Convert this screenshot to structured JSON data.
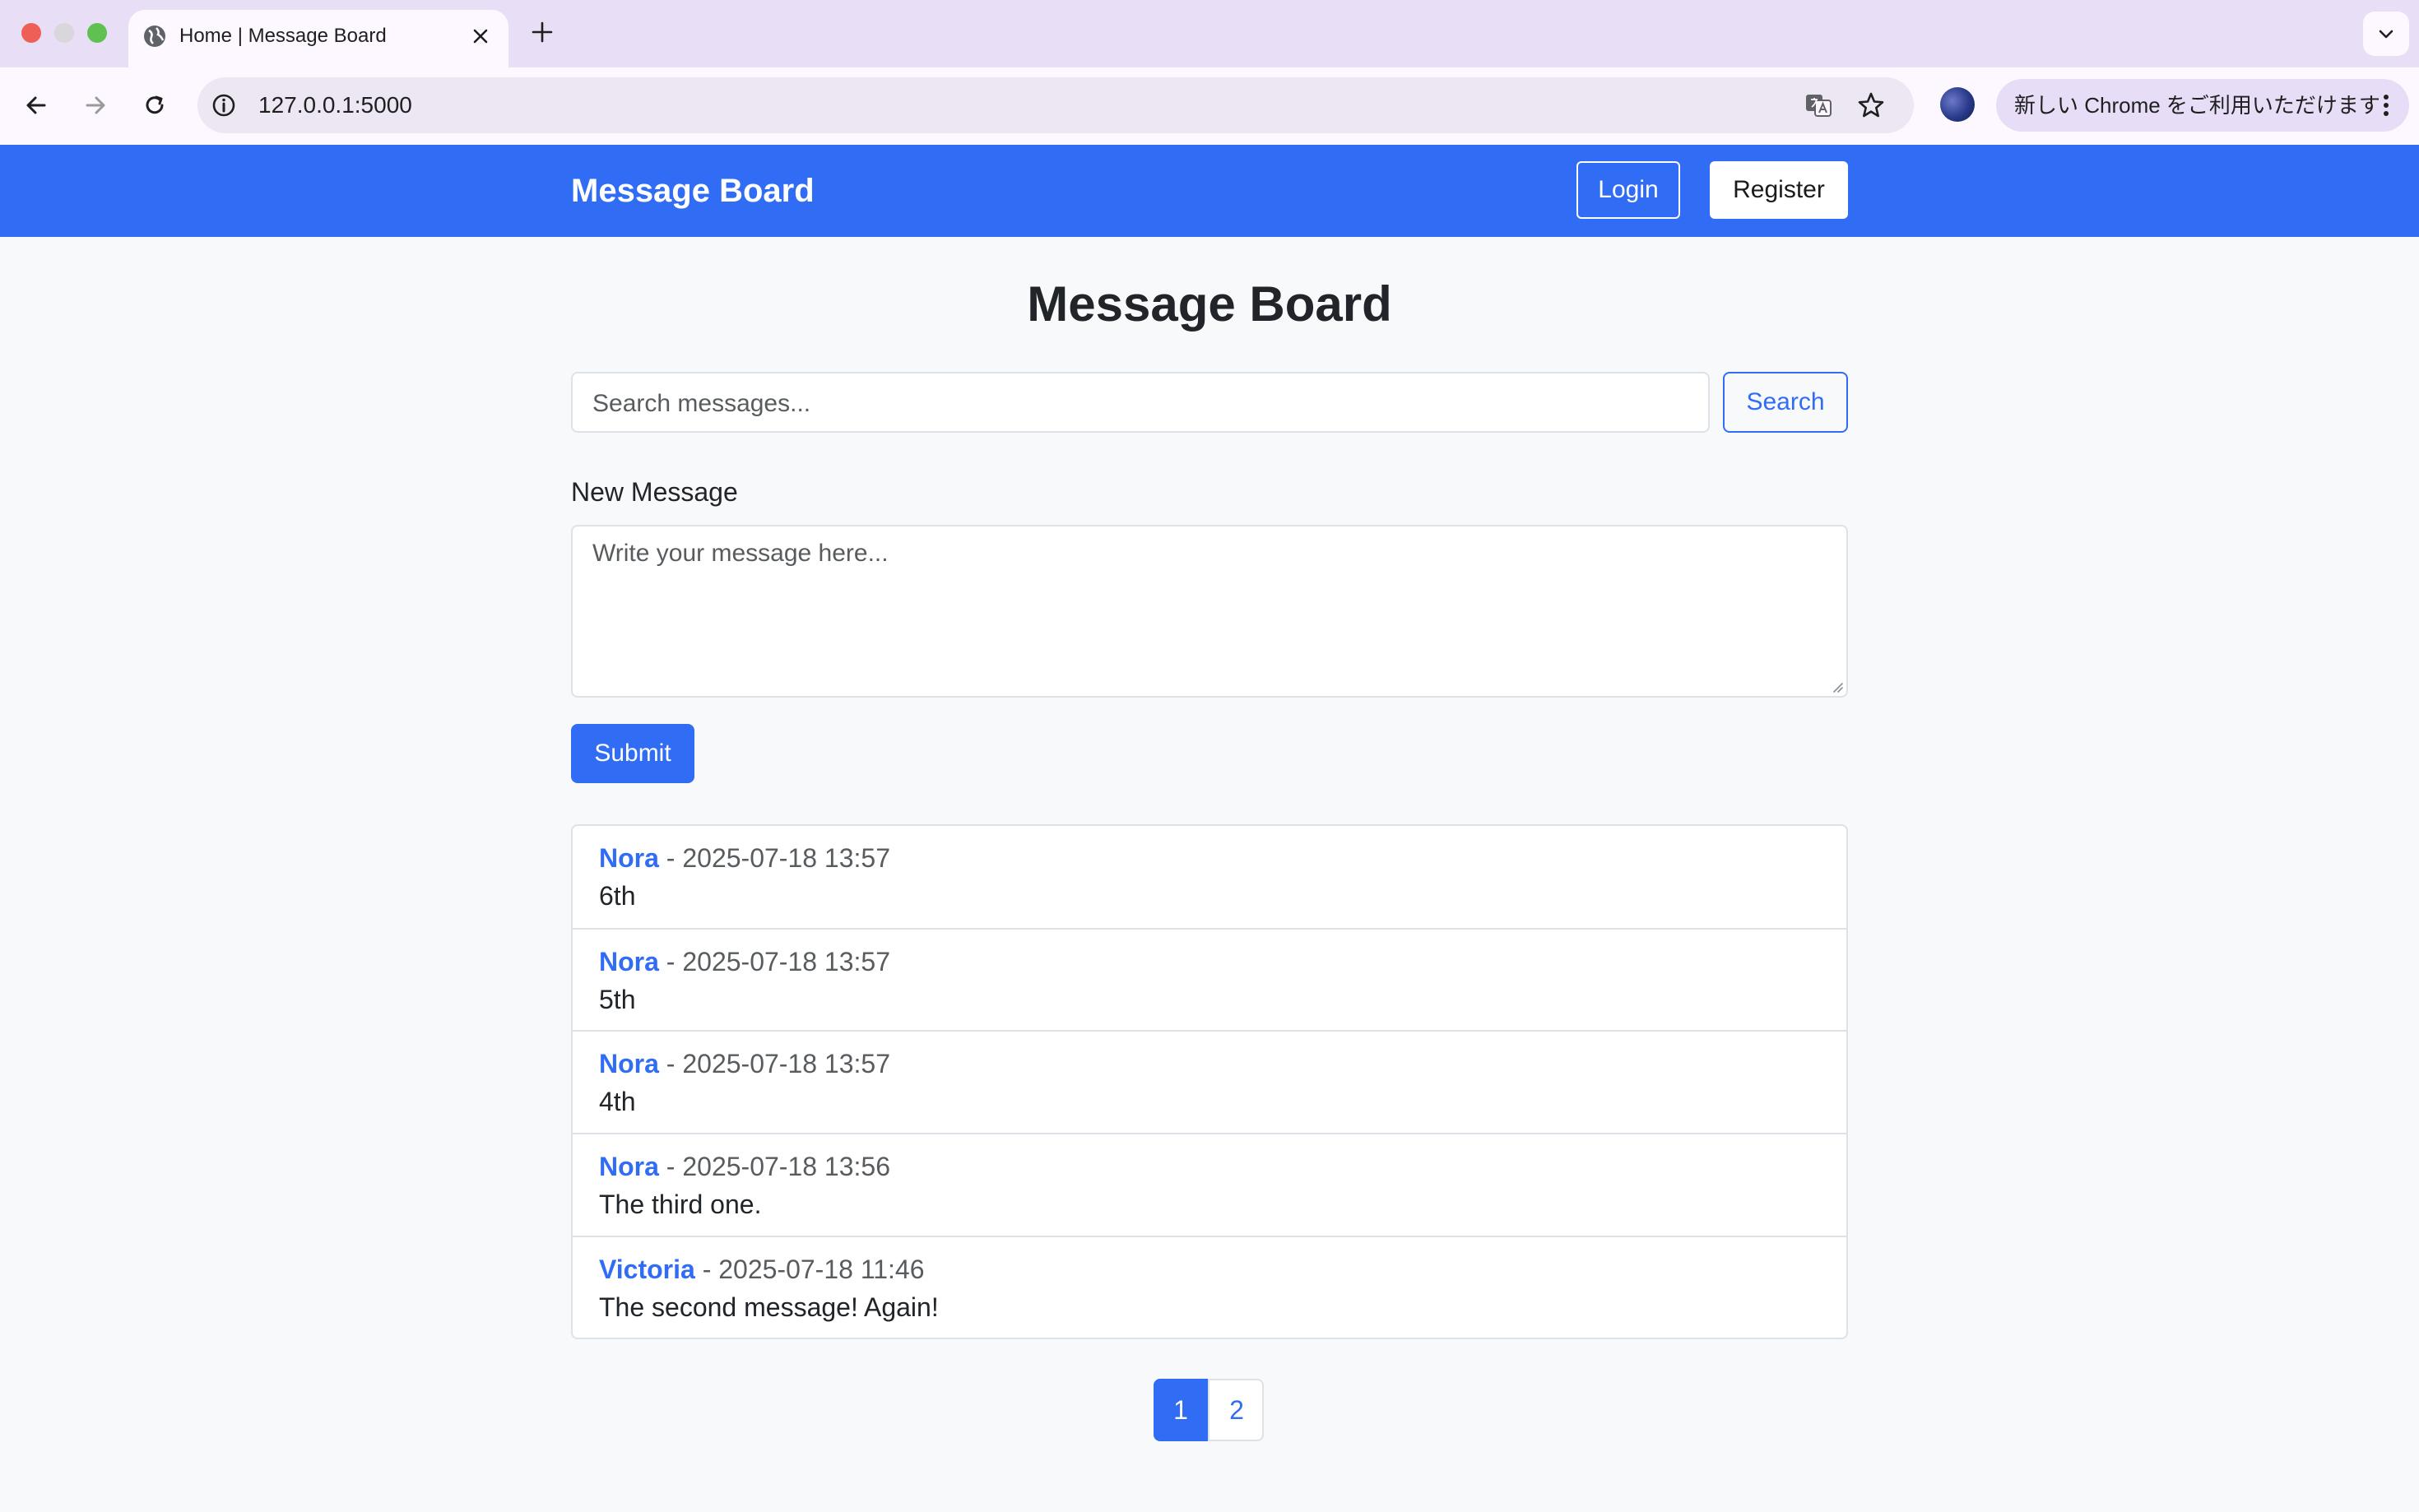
{
  "browser": {
    "tab_title": "Home | Message Board",
    "url": "127.0.0.1:5000",
    "update_notice": "新しい Chrome をご利用いただけます"
  },
  "site": {
    "brand": "Message Board",
    "login_label": "Login",
    "register_label": "Register"
  },
  "main": {
    "title": "Message Board",
    "search_placeholder": "Search messages...",
    "search_button": "Search",
    "new_message_label": "New Message",
    "message_placeholder": "Write your message here...",
    "submit_label": "Submit"
  },
  "messages": [
    {
      "author": "Nora",
      "separator": " - ",
      "timestamp": "2025-07-18 13:57",
      "body": "6th"
    },
    {
      "author": "Nora",
      "separator": " - ",
      "timestamp": "2025-07-18 13:57",
      "body": "5th"
    },
    {
      "author": "Nora",
      "separator": " - ",
      "timestamp": "2025-07-18 13:57",
      "body": "4th"
    },
    {
      "author": "Nora",
      "separator": " - ",
      "timestamp": "2025-07-18 13:56",
      "body": "The third one."
    },
    {
      "author": "Victoria",
      "separator": " - ",
      "timestamp": "2025-07-18 11:46",
      "body": "The second message! Again!"
    }
  ],
  "pagination": {
    "pages": [
      "1",
      "2"
    ],
    "current": "1"
  },
  "colors": {
    "primary": "#316cf4",
    "page_background": "#f8f9fa",
    "border": "#dee2e6",
    "tabstrip": "#e8def5"
  }
}
